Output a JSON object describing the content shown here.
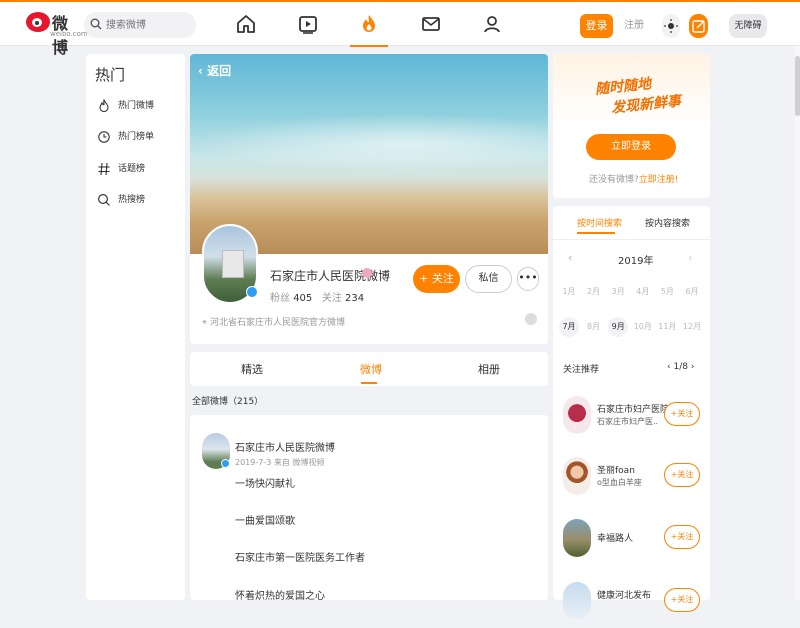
{
  "header": {
    "brand": "微博",
    "brand_sub": "weibo.com",
    "search_placeholder": "搜索微博",
    "login_label": "登录",
    "register_label": "注册",
    "accessibility_label": "无障碍",
    "accent_color": "#ff8200",
    "nav_icons": [
      "home-icon",
      "video-icon",
      "hot-fire-icon",
      "message-icon",
      "user-icon"
    ]
  },
  "left_nav": {
    "title": "热门",
    "items": [
      {
        "label": "热门微博",
        "icon": "fire-icon"
      },
      {
        "label": "热门榜单",
        "icon": "clock-icon"
      },
      {
        "label": "话题榜",
        "icon": "hash-icon"
      },
      {
        "label": "热搜榜",
        "icon": "search-icon"
      }
    ]
  },
  "profile": {
    "back_label": "返回",
    "name": "石家庄市人民医院微博",
    "fans_label": "粉丝",
    "fans_count": "405",
    "following_label": "关注",
    "following_count": "234",
    "follow_label": "+ 关注",
    "message_label": "私信",
    "more_label": "•••",
    "location": "河北省石家庄市人民医院官方微博"
  },
  "tabs": [
    {
      "label": "精选"
    },
    {
      "label": "微博",
      "active": true
    },
    {
      "label": "相册"
    }
  ],
  "feed": {
    "all_posts_label": "全部微博（215）",
    "post": {
      "author": "石家庄市人民医院微博",
      "meta": "2019-7-3 来自 微博视频",
      "lines": [
        "一场快闪献礼",
        "一曲爱国颂歌",
        "石家庄市第一医院医务工作者",
        "怀着炽热的爱国之心"
      ]
    }
  },
  "login_card": {
    "slogan_line1": "随时随地",
    "slogan_line2": "发现新鲜事",
    "login_now": "立即登录",
    "no_account": "还没有微博?",
    "register_now": "立即注册!"
  },
  "calendar": {
    "tab_time": "按时间搜索",
    "tab_content": "按内容搜索",
    "year": "2019年",
    "months": [
      {
        "label": "1月",
        "active": false
      },
      {
        "label": "2月",
        "active": false
      },
      {
        "label": "3月",
        "active": false
      },
      {
        "label": "4月",
        "active": false
      },
      {
        "label": "5月",
        "active": false
      },
      {
        "label": "6月",
        "active": false
      },
      {
        "label": "7月",
        "active": true
      },
      {
        "label": "8月",
        "active": false
      },
      {
        "label": "9月",
        "active": true
      },
      {
        "label": "10月",
        "active": false
      },
      {
        "label": "11月",
        "active": false
      },
      {
        "label": "12月",
        "active": false
      }
    ]
  },
  "recommend": {
    "title": "关注推荐",
    "page": "1/8",
    "follow_label": "+关注",
    "items": [
      {
        "name": "石家庄市妇产医院",
        "desc": "石家庄市妇产医..."
      },
      {
        "name": "圣丽foan",
        "desc": "o型血白羊座"
      },
      {
        "name": "幸福路人",
        "desc": ""
      },
      {
        "name": "健康河北发布",
        "desc": ""
      }
    ]
  }
}
